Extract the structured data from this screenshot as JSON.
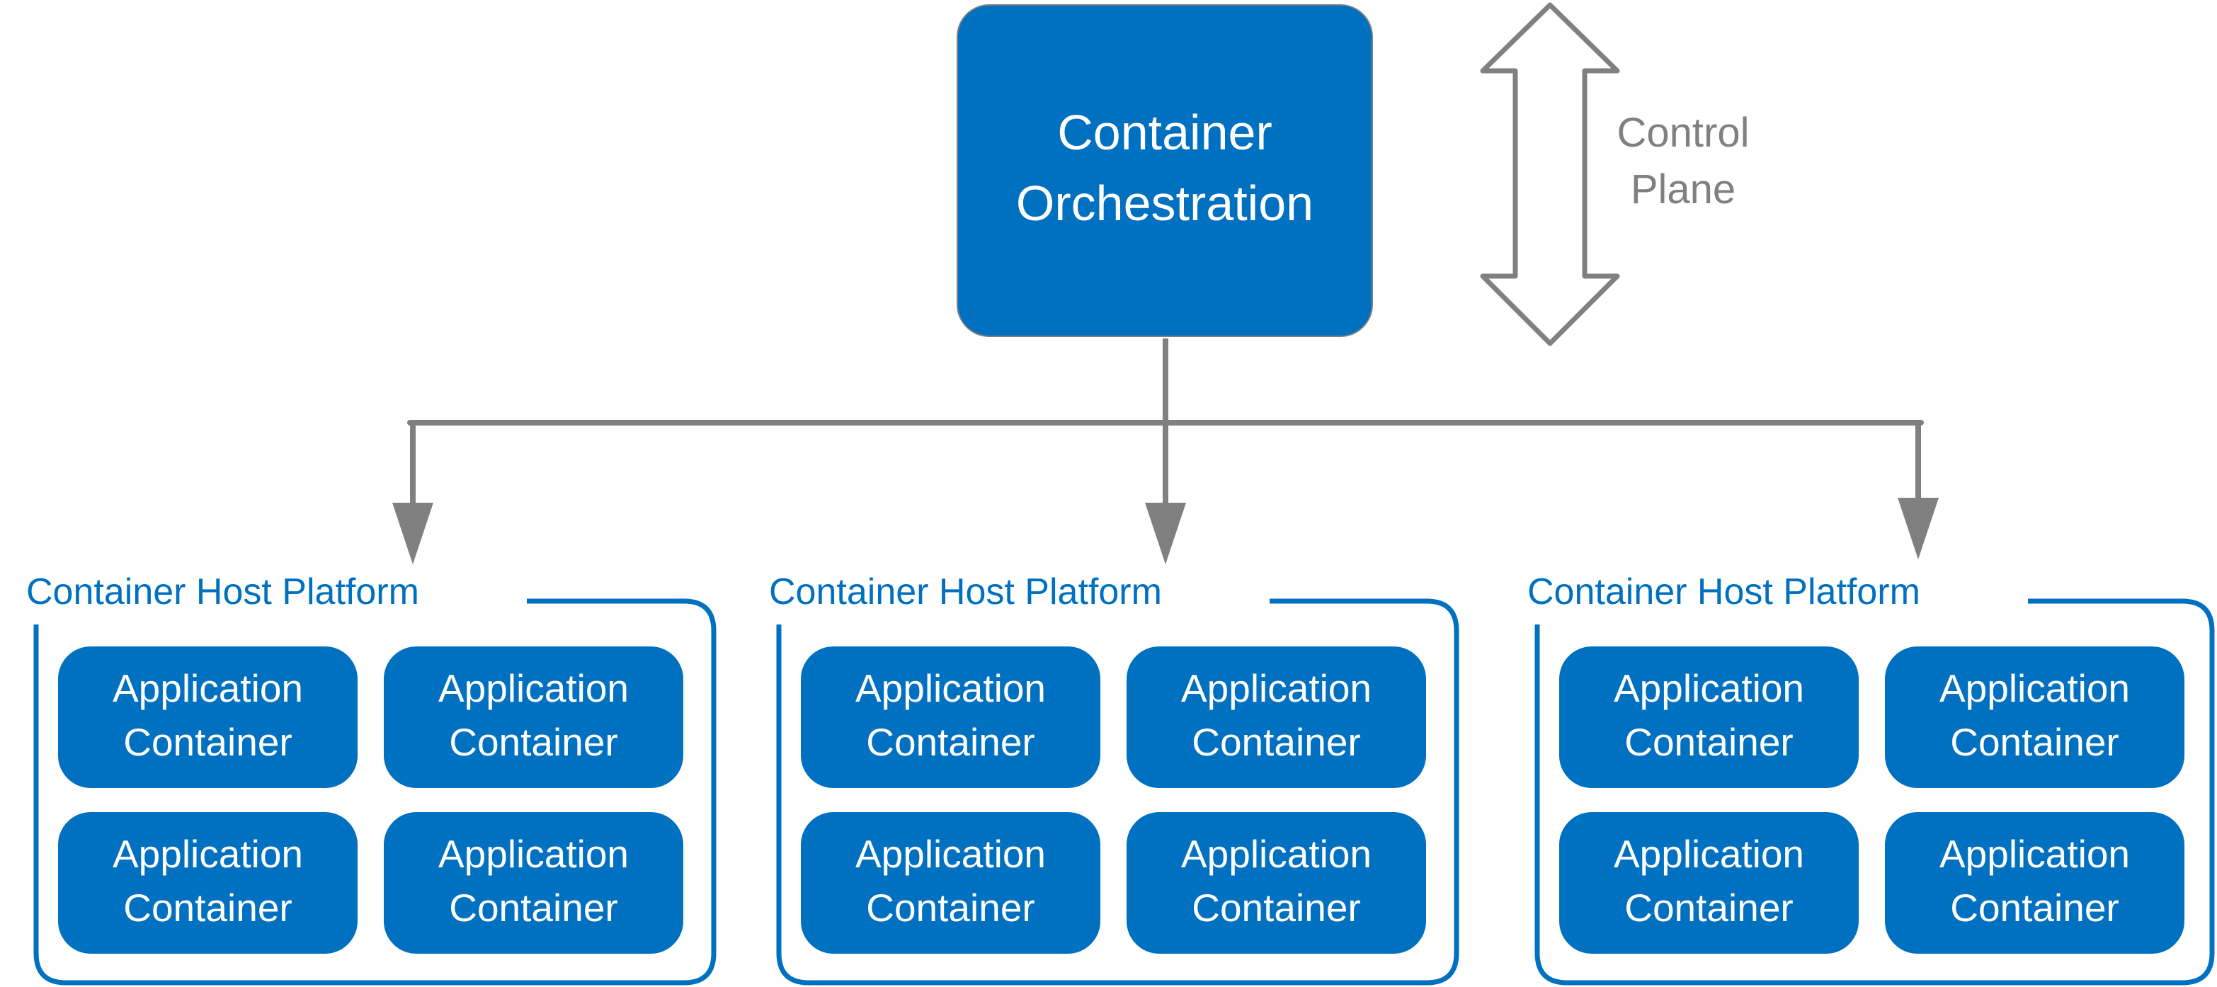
{
  "diagram": {
    "orchestrator": {
      "line1": "Container",
      "line2": "Orchestration"
    },
    "control_plane": {
      "line1": "Control",
      "line2": "Plane"
    },
    "host_platforms": [
      {
        "label": "Container Host Platform",
        "apps": [
          {
            "line1": "Application",
            "line2": "Container"
          },
          {
            "line1": "Application",
            "line2": "Container"
          },
          {
            "line1": "Application",
            "line2": "Container"
          },
          {
            "line1": "Application",
            "line2": "Container"
          }
        ]
      },
      {
        "label": "Container Host Platform",
        "apps": [
          {
            "line1": "Application",
            "line2": "Container"
          },
          {
            "line1": "Application",
            "line2": "Container"
          },
          {
            "line1": "Application",
            "line2": "Container"
          },
          {
            "line1": "Application",
            "line2": "Container"
          }
        ]
      },
      {
        "label": "Container Host Platform",
        "apps": [
          {
            "line1": "Application",
            "line2": "Container"
          },
          {
            "line1": "Application",
            "line2": "Container"
          },
          {
            "line1": "Application",
            "line2": "Container"
          },
          {
            "line1": "Application",
            "line2": "Container"
          }
        ]
      }
    ],
    "colors": {
      "primary_blue": "#0070C0",
      "connector_gray": "#808080",
      "text_white": "#FFFFFF"
    }
  }
}
